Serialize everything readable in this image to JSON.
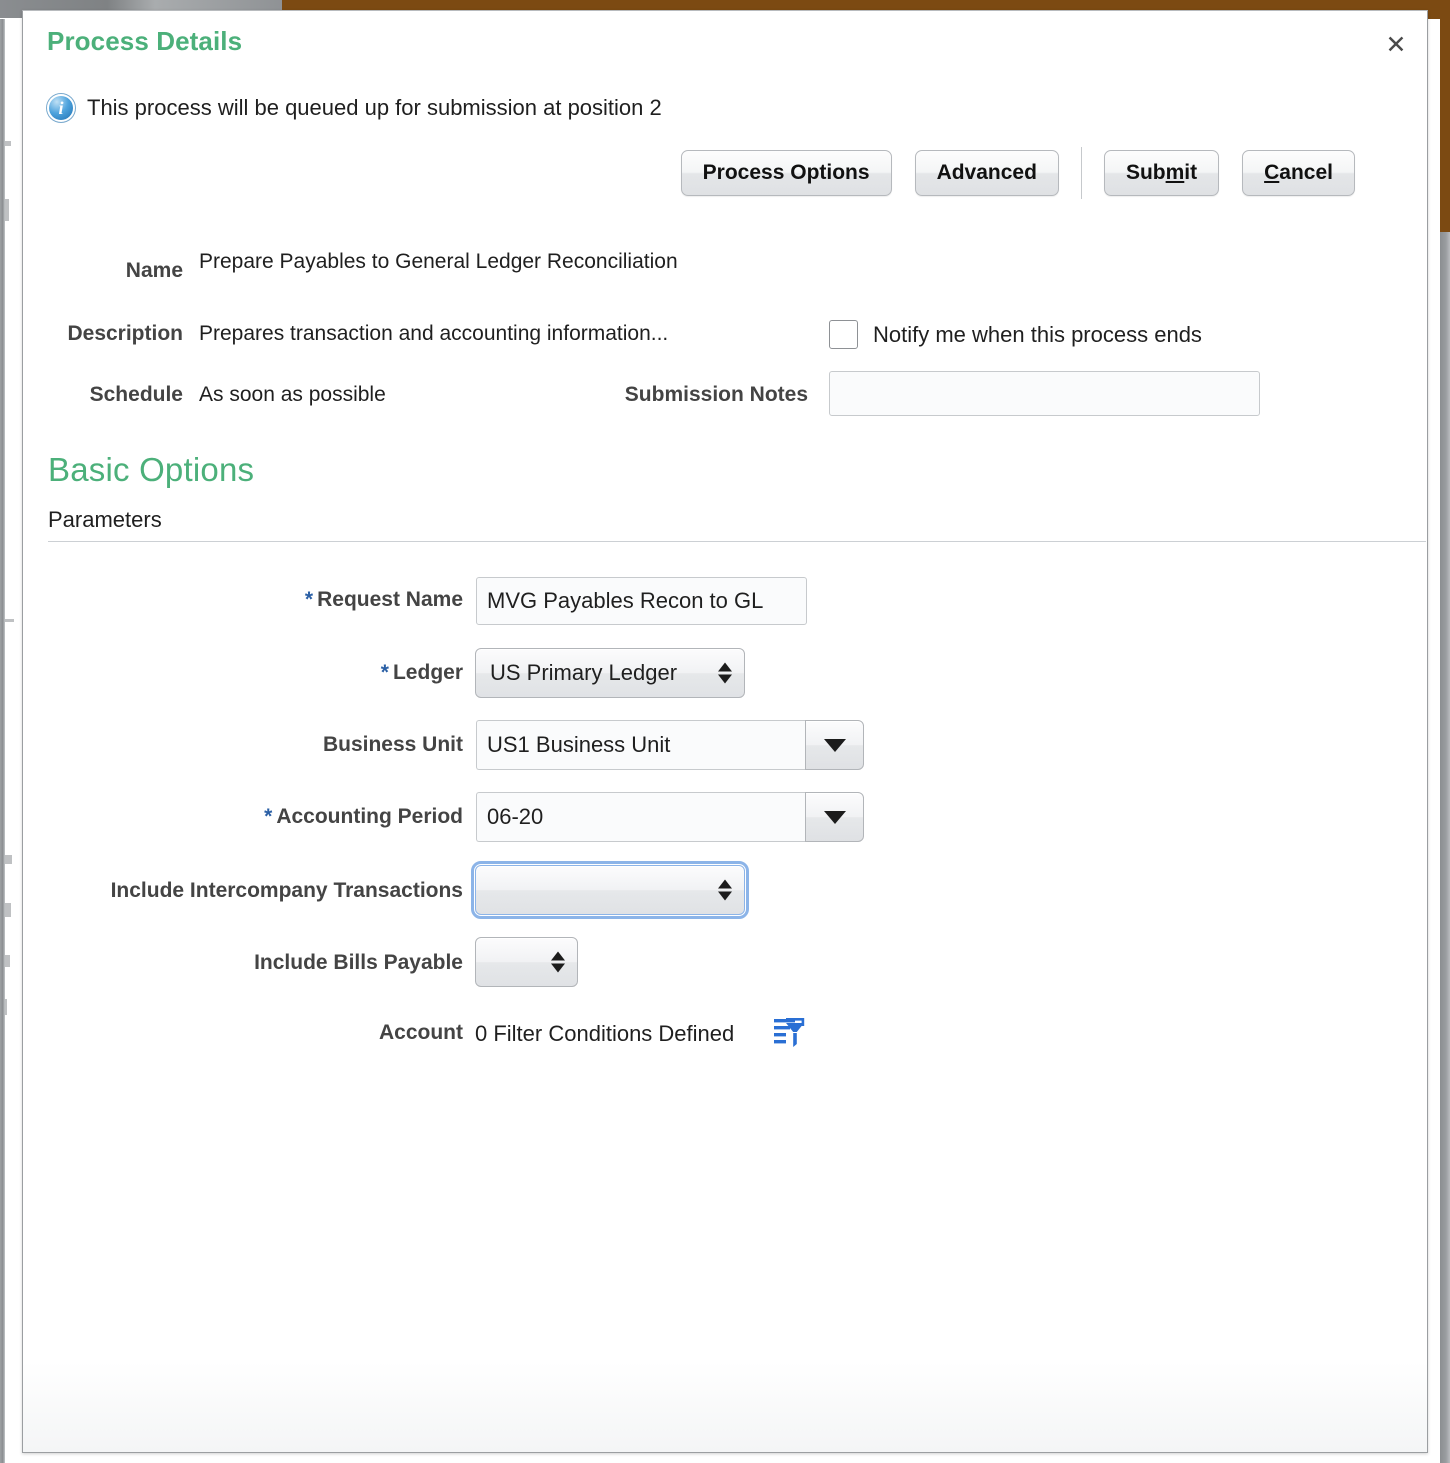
{
  "dialog": {
    "title": "Process Details",
    "close_icon": "close-icon",
    "info_icon": "info-icon",
    "info_message": "This process will be queued up for submission at position 2"
  },
  "toolbar": {
    "process_options_label": "Process Options",
    "advanced_label": "Advanced",
    "submit_label": "Sub",
    "submit_accesskey": "m",
    "submit_label_tail": "it",
    "cancel_accesskey": "C",
    "cancel_label_tail": "ancel"
  },
  "summary": {
    "name_label": "Name",
    "name_value": "Prepare Payables to General Ledger Reconciliation",
    "description_label": "Description",
    "description_value": "Prepares transaction and accounting information...",
    "schedule_label": "Schedule",
    "schedule_value": "As soon as possible",
    "notify_label": "Notify me when this process ends",
    "notify_checked": false,
    "submission_notes_label": "Submission Notes",
    "submission_notes_value": "",
    "submission_notes_placeholder": ""
  },
  "basic_options": {
    "section_title": "Basic Options",
    "parameters_label": "Parameters"
  },
  "parameters": {
    "request_name": {
      "label": "Request Name",
      "required": true,
      "required_marker": "*",
      "value": "MVG Payables Recon to GL ",
      "type": "text"
    },
    "ledger": {
      "label": "Ledger",
      "required": true,
      "required_marker": "*",
      "value": "US Primary Ledger",
      "type": "select",
      "focused": false
    },
    "business_unit": {
      "label": "Business Unit",
      "required": false,
      "value": "US1 Business Unit",
      "type": "lov",
      "dropdown_icon": "chevron-down-icon"
    },
    "accounting_period": {
      "label": "Accounting Period",
      "required": true,
      "required_marker": "*",
      "value": "06-20",
      "type": "lov",
      "dropdown_icon": "chevron-down-icon"
    },
    "include_intercompany_transactions": {
      "label": "Include Intercompany Transactions",
      "required": false,
      "value": "",
      "type": "select",
      "focused": true
    },
    "include_bills_payable": {
      "label": "Include Bills Payable",
      "required": false,
      "value": "",
      "type": "select",
      "focused": false
    },
    "account": {
      "label": "Account",
      "value": "0 Filter Conditions Defined",
      "filter_icon": "filter-icon"
    }
  },
  "colors": {
    "heading_green": "#4cb07a",
    "required_star_blue": "#2a5fa5",
    "filter_icon_blue": "#2a6fd4",
    "focus_ring_blue": "#8cb4e8",
    "browser_chrome_brown": "#7c4a12"
  }
}
